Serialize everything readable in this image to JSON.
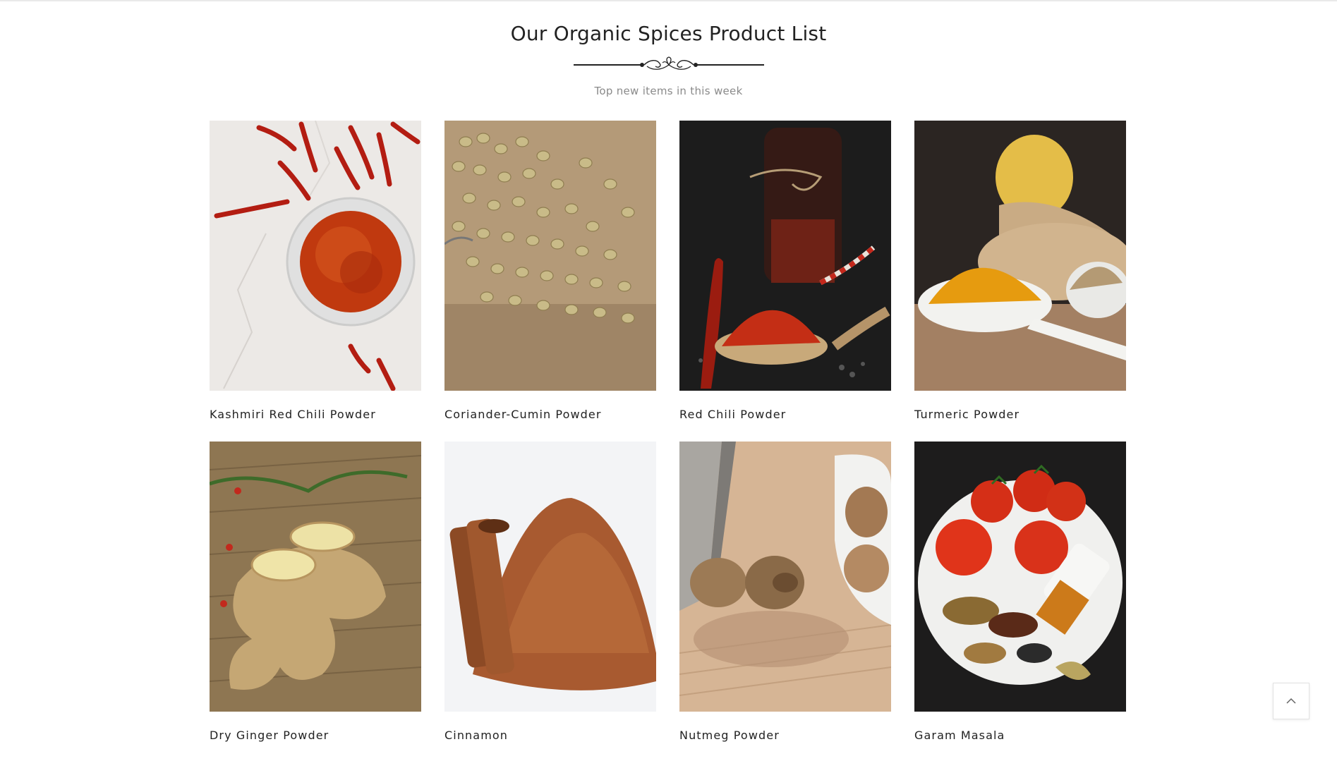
{
  "section": {
    "title": "Our Organic Spices Product List",
    "subtitle": "Top new items in this week"
  },
  "products": [
    {
      "name": "Kashmiri Red Chili Powder",
      "image": "chili-powder-bowl-photo"
    },
    {
      "name": "Coriander-Cumin Powder",
      "image": "coriander-seeds-photo"
    },
    {
      "name": "Red Chili Powder",
      "image": "red-chili-spoon-photo"
    },
    {
      "name": "Turmeric Powder",
      "image": "turmeric-spoon-photo"
    },
    {
      "name": "Dry Ginger Powder",
      "image": "ginger-root-photo"
    },
    {
      "name": "Cinnamon",
      "image": "cinnamon-powder-photo"
    },
    {
      "name": "Nutmeg Powder",
      "image": "nutmeg-grater-photo"
    },
    {
      "name": "Garam Masala",
      "image": "garam-masala-plate-photo"
    }
  ],
  "icons": {
    "back_to_top": "chevron-up-icon",
    "divider": "ornament-divider-icon"
  }
}
